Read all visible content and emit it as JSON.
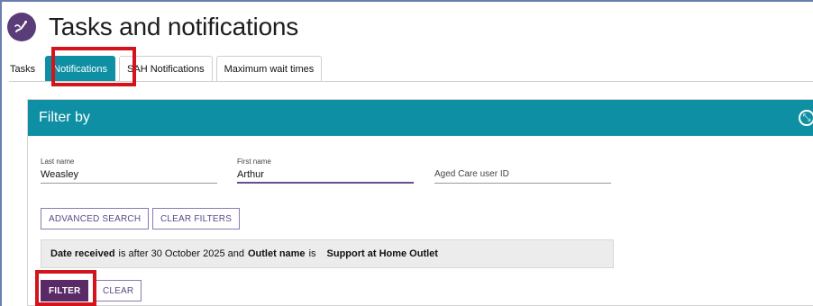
{
  "header": {
    "title": "Tasks and notifications",
    "logo_icon": "hand-writing-icon"
  },
  "tabs": [
    {
      "label": "Tasks",
      "active": false
    },
    {
      "label": "Notifications",
      "active": true
    },
    {
      "label": "SAH Notifications",
      "active": false
    },
    {
      "label": "Maximum wait times",
      "active": false
    }
  ],
  "filter": {
    "title": "Filter by",
    "expand_icon": "expand-icon",
    "fields": {
      "last_name": {
        "label": "Last name",
        "value": "Weasley"
      },
      "first_name": {
        "label": "First name",
        "value": "Arthur"
      },
      "aged_care_id": {
        "placeholder": "Aged Care user ID",
        "value": ""
      }
    },
    "advanced_search_label": "ADVANCED SEARCH",
    "clear_filters_label": "CLEAR FILTERS",
    "summary": {
      "part1_key": "Date received",
      "part1_text": "is after 30 October 2025 and",
      "part2_key": "Outlet name",
      "part2_text": "is",
      "part2_value": "Support at Home Outlet"
    },
    "filter_label": "FILTER",
    "clear_label": "CLEAR"
  },
  "colors": {
    "accent": "#0f8fa3",
    "primary_button": "#5a2a66",
    "highlight": "#d4141d"
  }
}
